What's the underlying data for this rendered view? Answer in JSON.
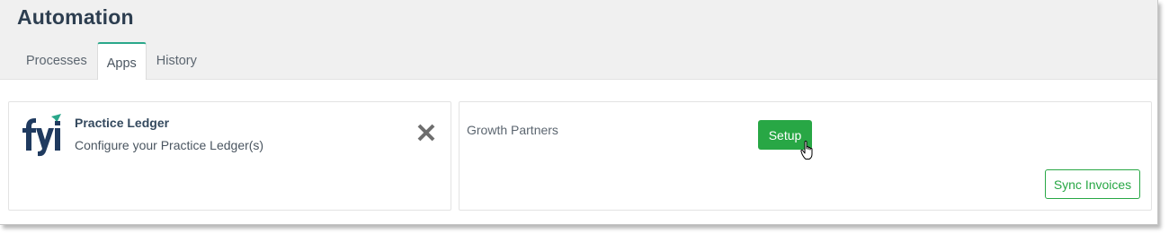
{
  "page": {
    "title": "Automation"
  },
  "tabs": [
    {
      "label": "Processes",
      "active": false
    },
    {
      "label": "Apps",
      "active": true
    },
    {
      "label": "History",
      "active": false
    }
  ],
  "apps": {
    "practice_ledger": {
      "title": "Practice Ledger",
      "description": "Configure your Practice Ledger(s)",
      "logo_text": "fyi",
      "remove_icon": "close-x-icon"
    },
    "growth_partners": {
      "name": "Growth Partners",
      "setup_label": "Setup",
      "sync_label": "Sync Invoices"
    }
  },
  "colors": {
    "accent_tab": "#2aa78a",
    "primary_button": "#28a745",
    "logo_dark": "#1f3a5f",
    "logo_accent": "#2aa78a",
    "header_bg": "#f0f0f0"
  }
}
